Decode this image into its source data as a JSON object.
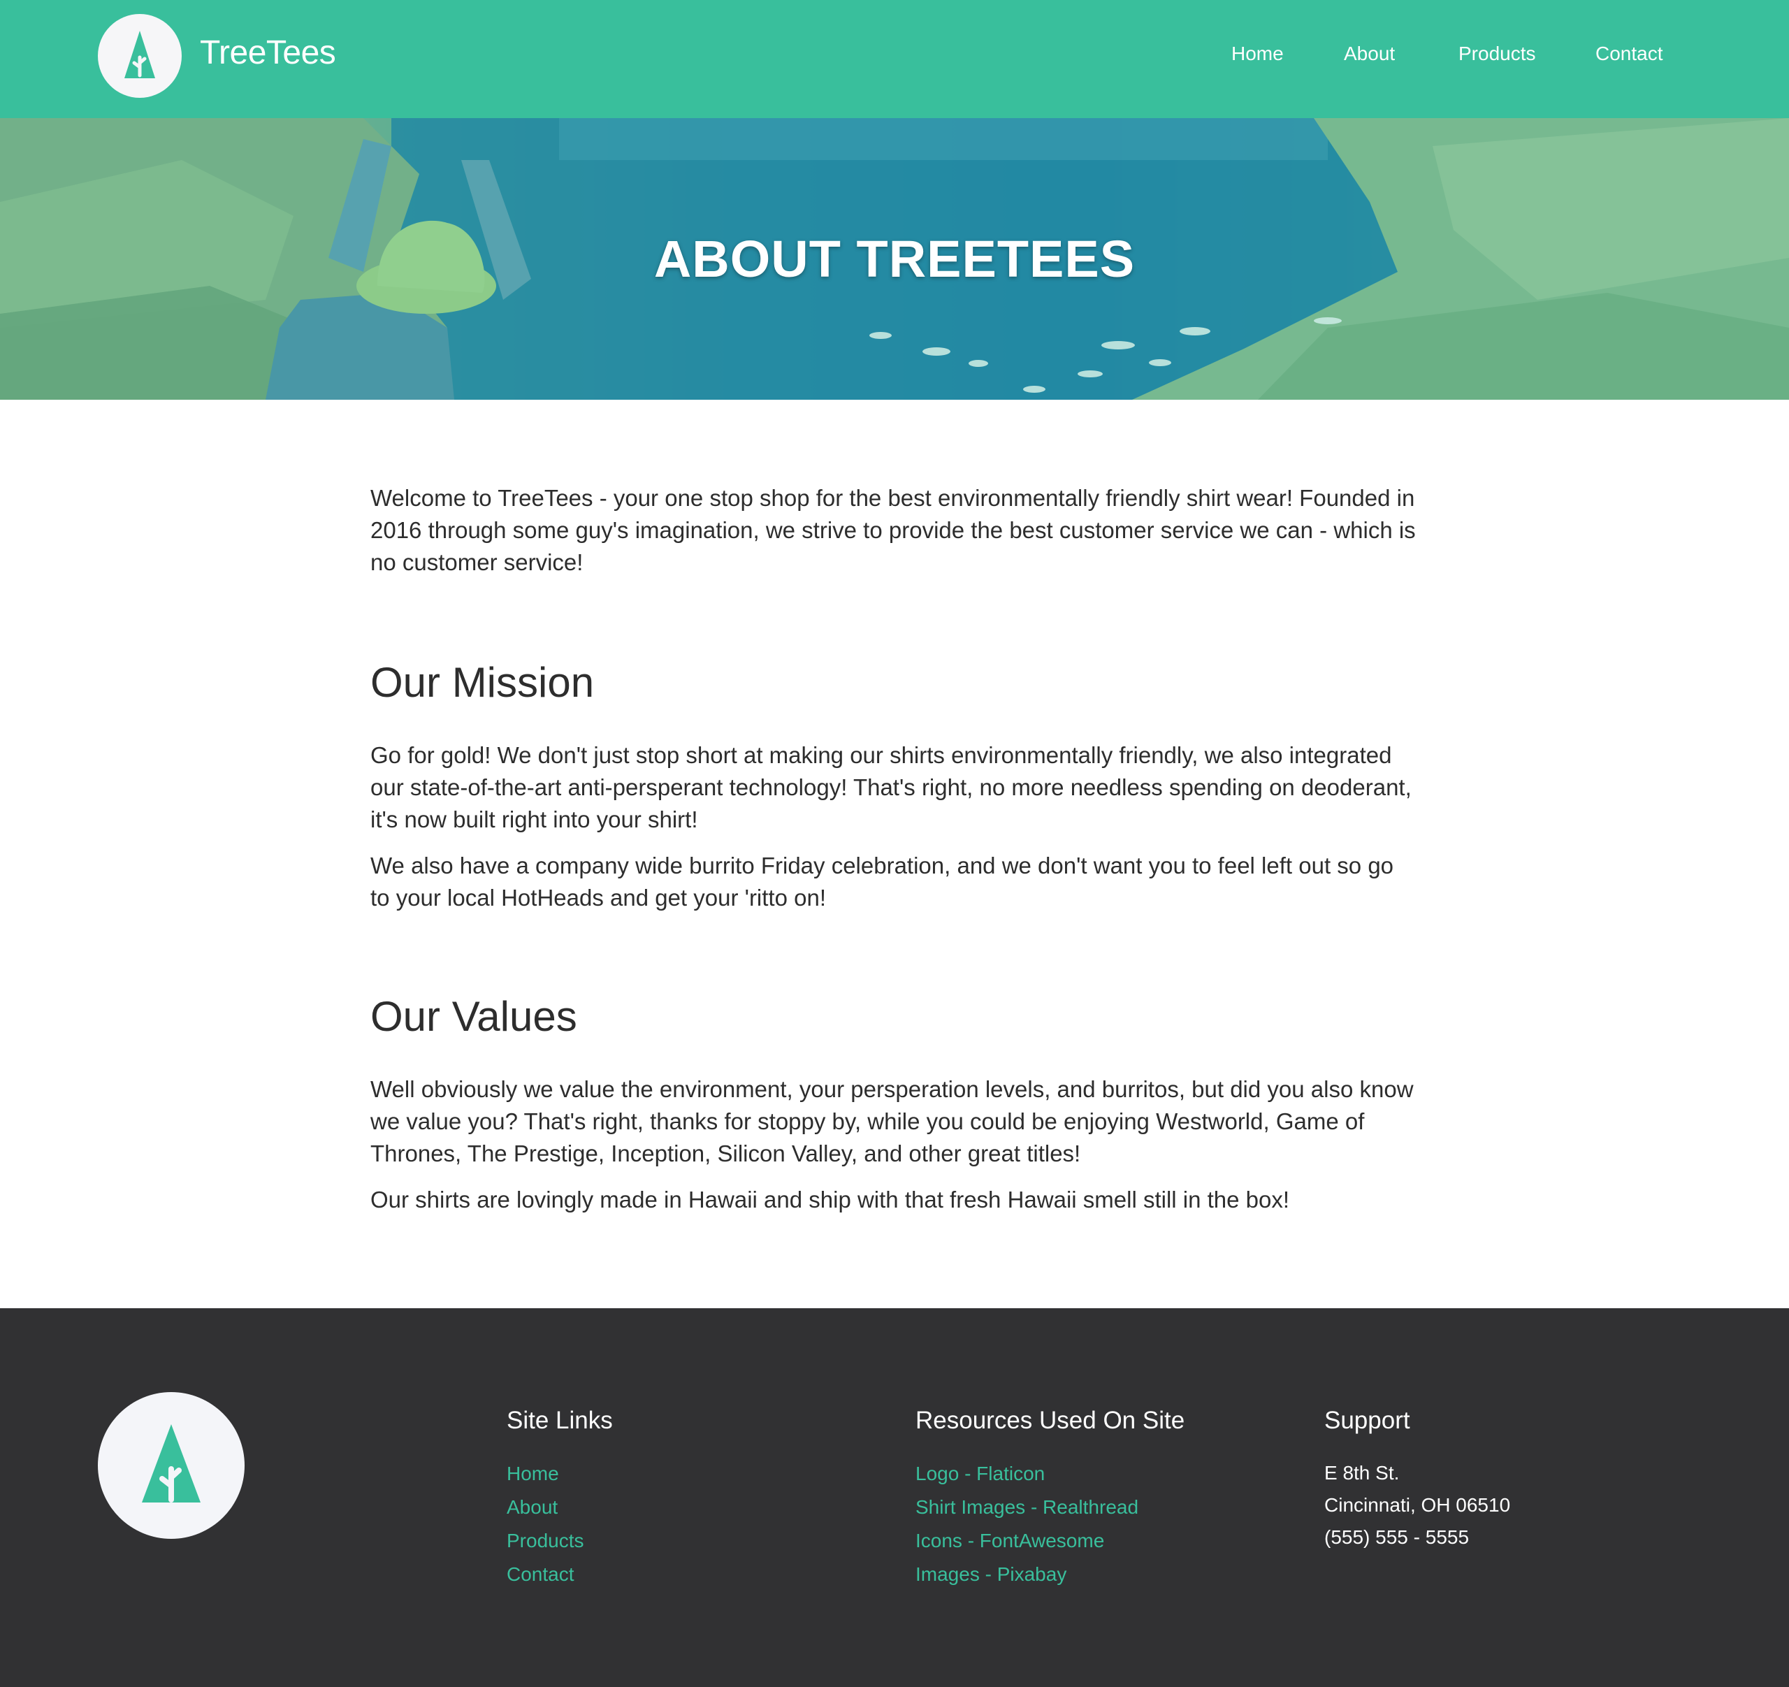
{
  "colors": {
    "brand": "#39bf9c",
    "footer_bg": "#313133",
    "text": "#2d2d2d",
    "logo_circle": "#f6f6f8"
  },
  "header": {
    "logo_icon": "tree-icon",
    "brand_name": "TreeTees",
    "nav": [
      "Home",
      "About",
      "Products",
      "Contact"
    ]
  },
  "hero": {
    "title": "ABOUT TREETEES"
  },
  "main": {
    "intro": "Welcome to TreeTees - your one stop shop for the best environmentally friendly shirt wear! Founded in 2016 through some guy's imagination, we strive to provide the best customer service we can - which is no customer service!",
    "mission": {
      "heading": "Our Mission",
      "paragraphs": [
        "Go for gold! We don't just stop short at making our shirts environmentally friendly, we also integrated our state-of-the-art anti-persperant technology! That's right, no more needless spending on deoderant, it's now built right into your shirt!",
        "We also have a company wide burrito Friday celebration, and we don't want you to feel left out so go to your local HotHeads and get your 'ritto on!"
      ]
    },
    "values": {
      "heading": "Our Values",
      "paragraphs": [
        "Well obviously we value the environment, your persperation levels, and burritos, but did you also know we value you? That's right, thanks for stoppy by, while you could be enjoying Westworld, Game of Thrones, The Prestige, Inception, Silicon Valley, and other great titles!",
        "Our shirts are lovingly made in Hawaii and ship with that fresh Hawaii smell still in the box!"
      ]
    }
  },
  "footer": {
    "logo_icon": "tree-icon",
    "site_links": {
      "heading": "Site Links",
      "items": [
        "Home",
        "About",
        "Products",
        "Contact"
      ]
    },
    "resources": {
      "heading": "Resources Used On Site",
      "items": [
        "Logo - Flaticon",
        "Shirt Images - Realthread",
        "Icons - FontAwesome",
        "Images - Pixabay"
      ]
    },
    "support": {
      "heading": "Support",
      "lines": [
        "E 8th St.",
        "Cincinnati, OH 06510",
        "(555) 555 - 5555"
      ]
    }
  }
}
